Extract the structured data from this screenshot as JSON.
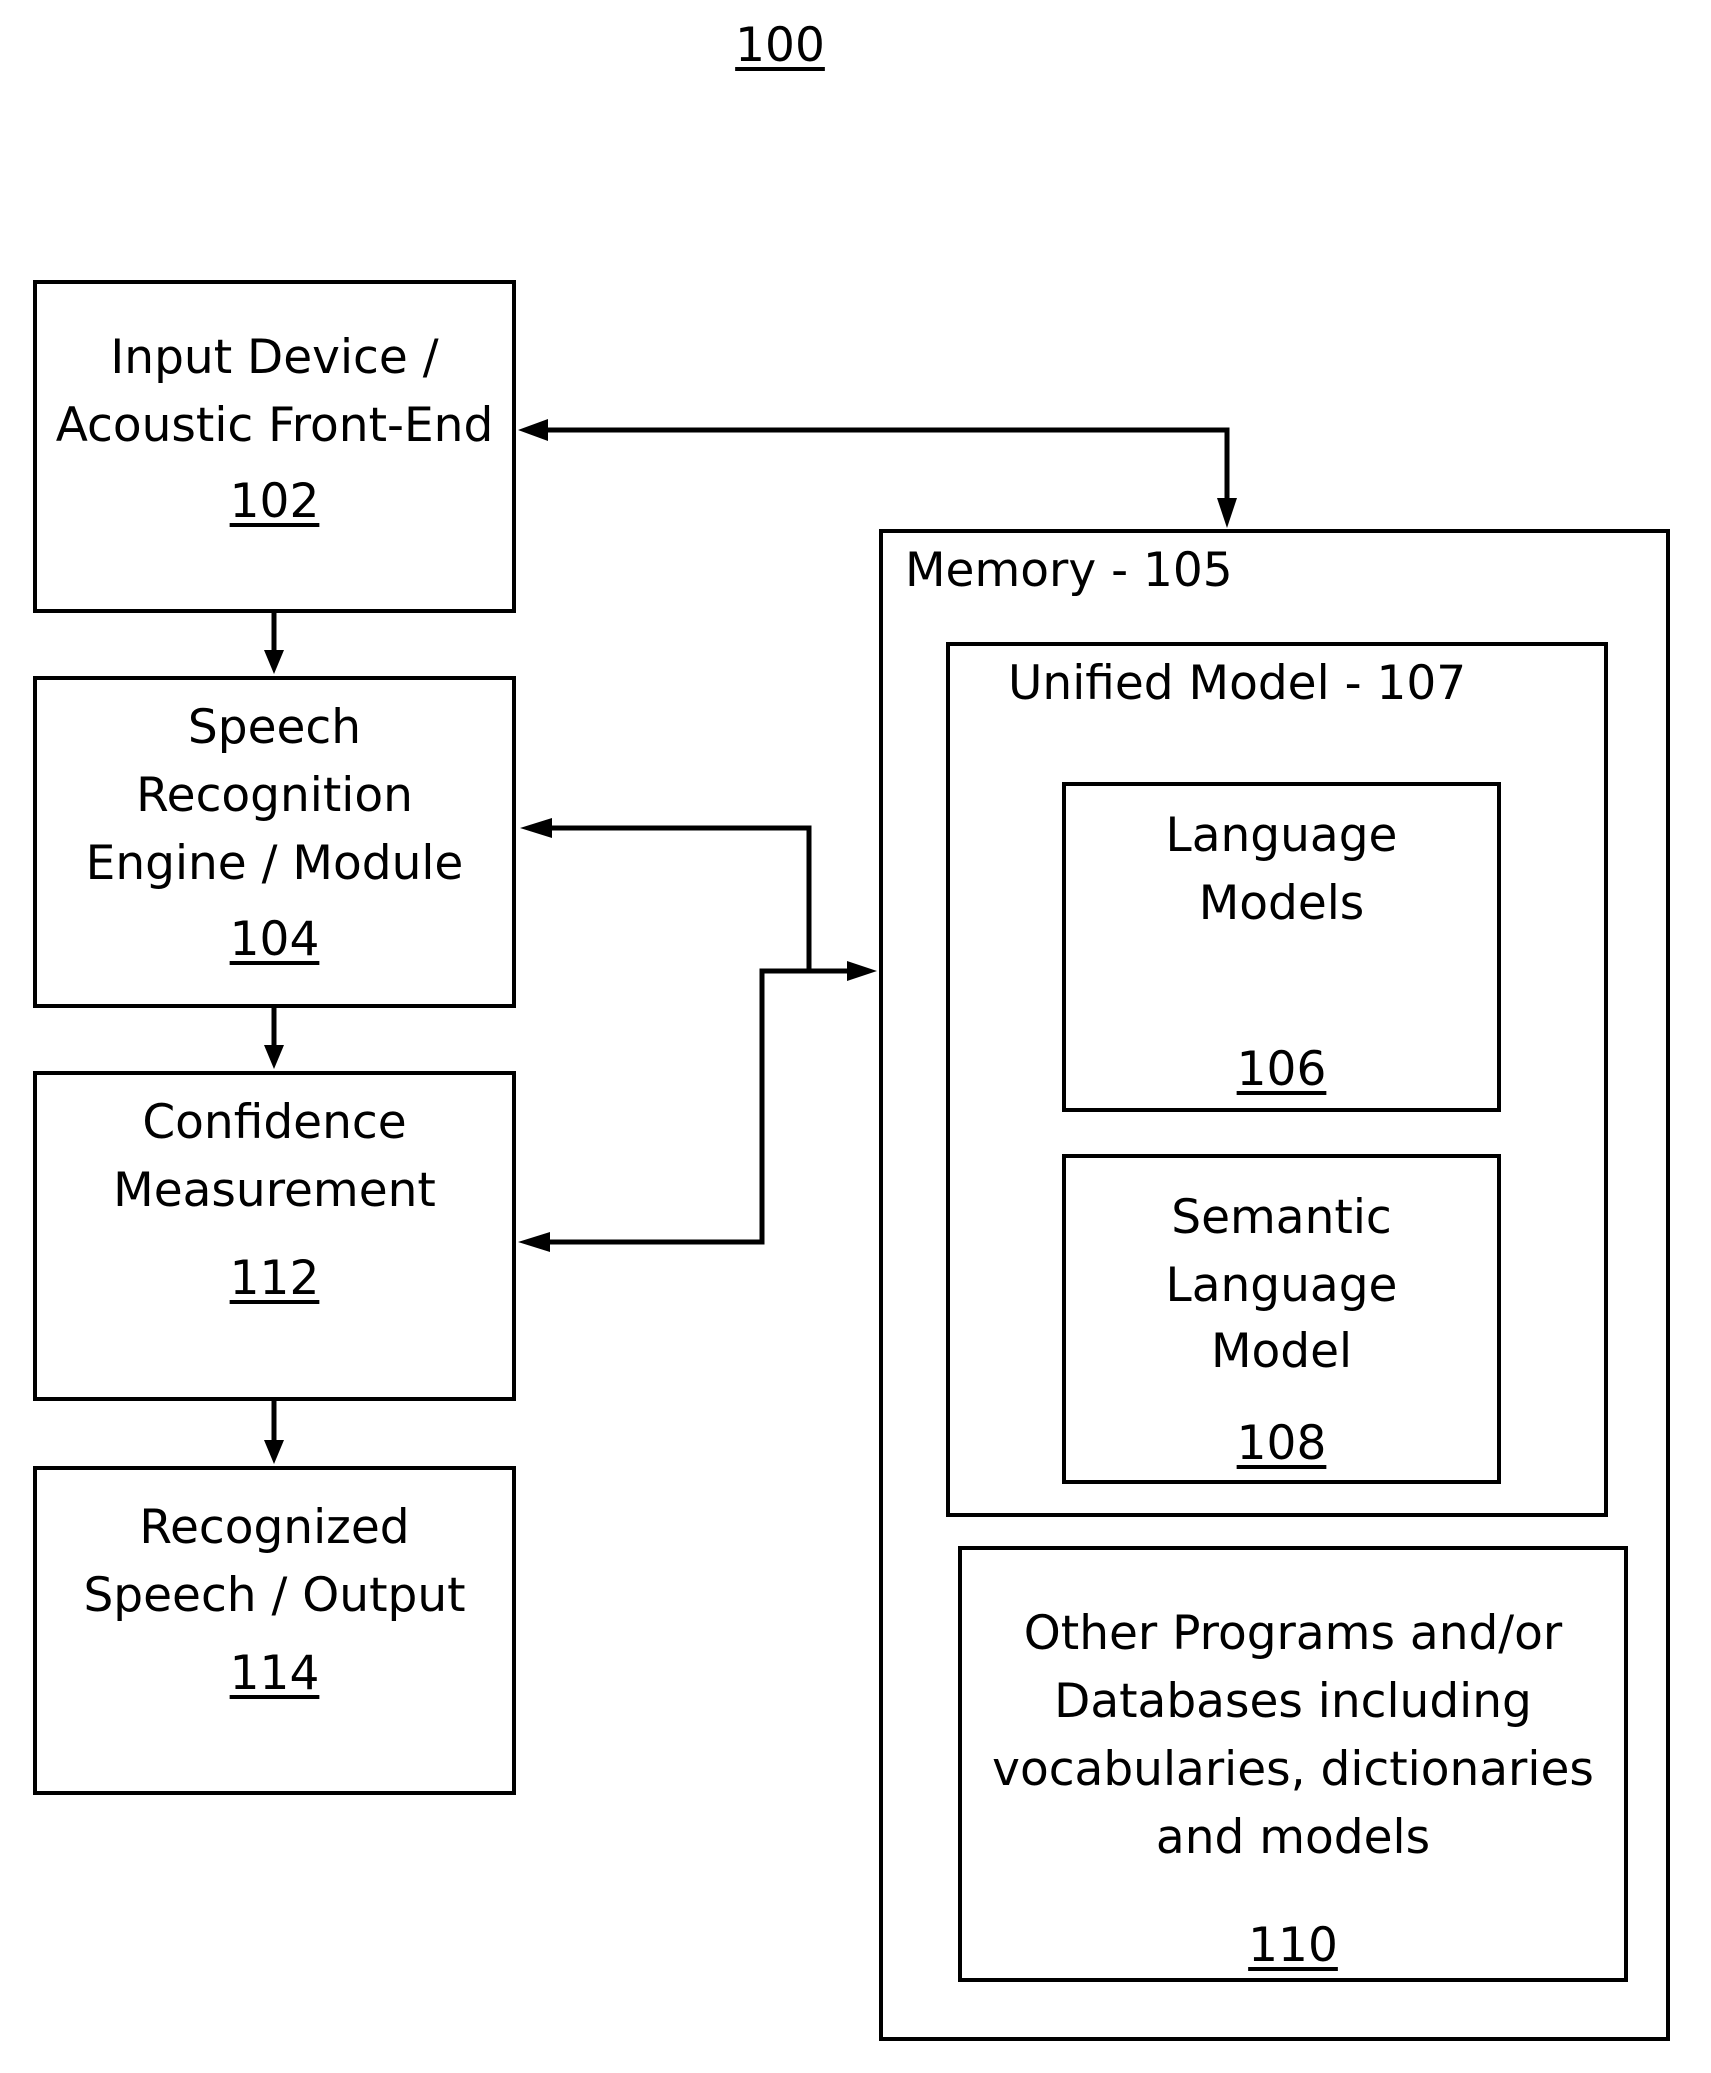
{
  "figure": {
    "number": "100"
  },
  "blocks": {
    "input_device": {
      "lines": [
        "Input Device /",
        "Acoustic Front-End"
      ],
      "ref": "102"
    },
    "speech_recognition": {
      "lines": [
        "Speech",
        "Recognition",
        "Engine / Module"
      ],
      "ref": "104"
    },
    "confidence": {
      "lines": [
        "Confidence",
        "Measurement"
      ],
      "ref": "112"
    },
    "recognized_output": {
      "lines": [
        "Recognized",
        "Speech / Output"
      ],
      "ref": "114"
    },
    "memory": {
      "title": "Memory - 105"
    },
    "unified_model": {
      "title": "Unified Model - 107"
    },
    "language_models": {
      "lines": [
        "Language",
        "Models"
      ],
      "ref": "106"
    },
    "semantic_language_model": {
      "lines": [
        "Semantic",
        "Language",
        "Model"
      ],
      "ref": "108"
    },
    "other_programs": {
      "lines": [
        "Other Programs and/or",
        "Databases including",
        "vocabularies, dictionaries",
        "and models"
      ],
      "ref": "110"
    }
  },
  "connections": [
    {
      "from": "input_device",
      "to": "speech_recognition",
      "type": "arrow"
    },
    {
      "from": "speech_recognition",
      "to": "confidence",
      "type": "arrow"
    },
    {
      "from": "confidence",
      "to": "recognized_output",
      "type": "arrow"
    },
    {
      "from": "input_device",
      "to": "memory",
      "type": "bidirectional"
    },
    {
      "from": "memory",
      "to": "speech_recognition",
      "type": "bidirectional"
    },
    {
      "from": "memory",
      "to": "confidence",
      "type": "bidirectional"
    }
  ]
}
